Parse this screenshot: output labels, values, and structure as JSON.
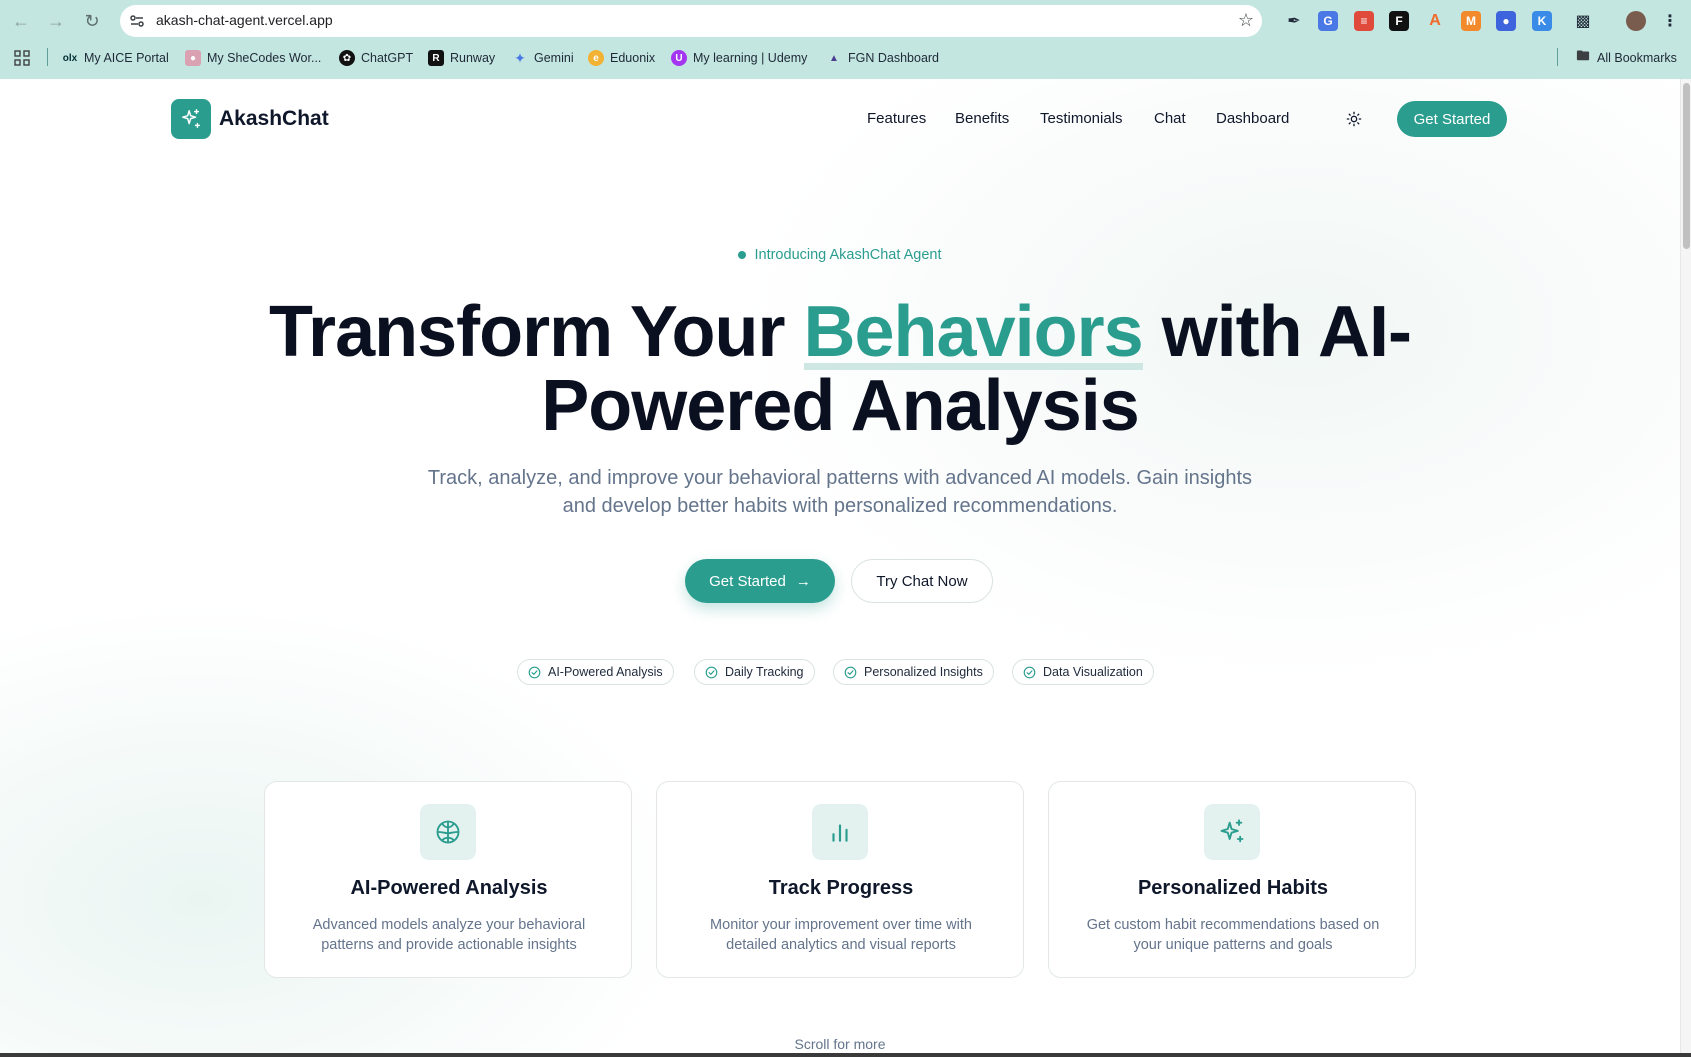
{
  "browser": {
    "url": "akash-chat-agent.vercel.app",
    "bookmarks": [
      {
        "label": "My AICE Portal",
        "icon": "olx-icon"
      },
      {
        "label": "My SheCodes Wor...",
        "icon": "shecodes-icon"
      },
      {
        "label": "ChatGPT",
        "icon": "openai-icon"
      },
      {
        "label": "Runway",
        "icon": "runway-icon"
      },
      {
        "label": "Gemini",
        "icon": "gemini-icon"
      },
      {
        "label": "Eduonix",
        "icon": "eduonix-icon"
      },
      {
        "label": "My learning | Udemy",
        "icon": "udemy-icon"
      },
      {
        "label": "FGN Dashboard",
        "icon": "fgn-icon"
      }
    ],
    "all_bookmarks_label": "All Bookmarks"
  },
  "header": {
    "brand": "AkashChat",
    "nav": [
      "Features",
      "Benefits",
      "Testimonials",
      "Chat",
      "Dashboard"
    ],
    "cta_label": "Get Started"
  },
  "hero": {
    "badge": "Introducing AkashChat Agent",
    "title_part1": "Transform Your ",
    "title_accent": "Behaviors",
    "title_part2": " with AI-Powered Analysis",
    "subtitle": "Track, analyze, and improve your behavioral patterns with advanced AI models. Gain insights and develop better habits with personalized recommendations.",
    "primary_button": "Get Started",
    "secondary_button": "Try Chat Now",
    "chips": [
      "AI-Powered Analysis",
      "Daily Tracking",
      "Personalized Insights",
      "Data Visualization"
    ]
  },
  "features": [
    {
      "title": "AI-Powered Analysis",
      "description": "Advanced models analyze your behavioral patterns and provide actionable insights",
      "icon": "brain-icon"
    },
    {
      "title": "Track Progress",
      "description": "Monitor your improvement over time with detailed analytics and visual reports",
      "icon": "bar-chart-icon"
    },
    {
      "title": "Personalized Habits",
      "description": "Get custom habit recommendations based on your unique patterns and goals",
      "icon": "sparkles-icon"
    }
  ],
  "scroll_hint": "Scroll for more",
  "colors": {
    "accent": "#2a9d8f",
    "chrome": "#c3e6e1",
    "text": "#0f172a",
    "muted": "#64748b"
  }
}
